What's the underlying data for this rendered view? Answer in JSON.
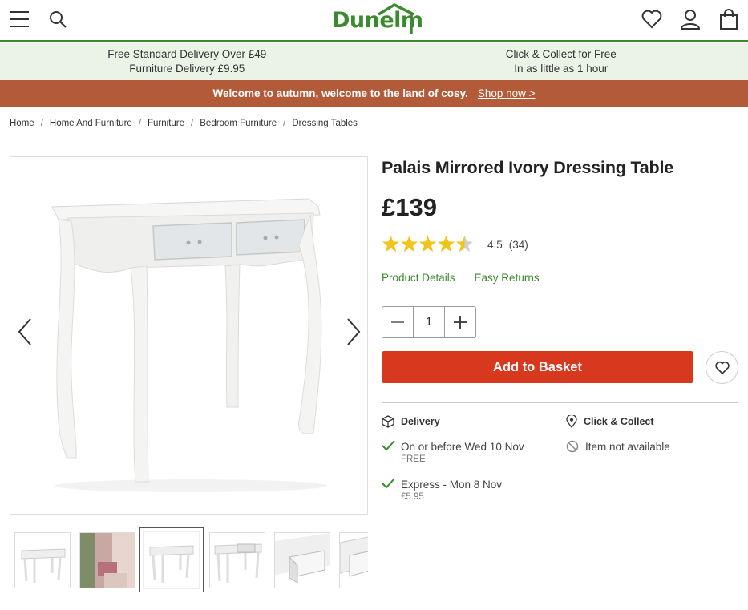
{
  "header": {
    "logo_text": "Dunelm",
    "brand_color": "#3c8a2e",
    "icons": [
      "menu-icon",
      "search-icon",
      "heart-icon",
      "account-icon",
      "basket-icon"
    ]
  },
  "infobar": {
    "left_line1": "Free Standard Delivery Over £49",
    "left_line2": "Furniture Delivery £9.95",
    "right_line1": "Click & Collect for Free",
    "right_line2": "In as little as 1 hour"
  },
  "promo": {
    "text": "Welcome to autumn, welcome to the land of cosy.",
    "link": "Shop now >",
    "color": "#b35a38"
  },
  "breadcrumb": {
    "items": [
      "Home",
      "Home And Furniture",
      "Furniture",
      "Bedroom Furniture",
      "Dressing Tables"
    ],
    "separator": "/"
  },
  "product": {
    "title": "Palais Mirrored Ivory Dressing Table",
    "price": "£139",
    "rating_value": 4.5,
    "rating_text": "4.5",
    "review_count": "(34)",
    "star_color": "#f0c419",
    "links": [
      "Product Details",
      "Easy Returns"
    ],
    "quantity": "1",
    "add_to_basket": "Add to Basket",
    "button_color": "#d8381e"
  },
  "gallery": {
    "thumbnail_count": 6,
    "selected_index": 2
  },
  "delivery": {
    "heading": "Delivery",
    "options": [
      {
        "label": "On or before Wed 10 Nov",
        "price": "FREE"
      },
      {
        "label": "Express - Mon 8 Nov",
        "price": "£5.95"
      }
    ]
  },
  "collect": {
    "heading": "Click & Collect",
    "status": "Item not available"
  }
}
